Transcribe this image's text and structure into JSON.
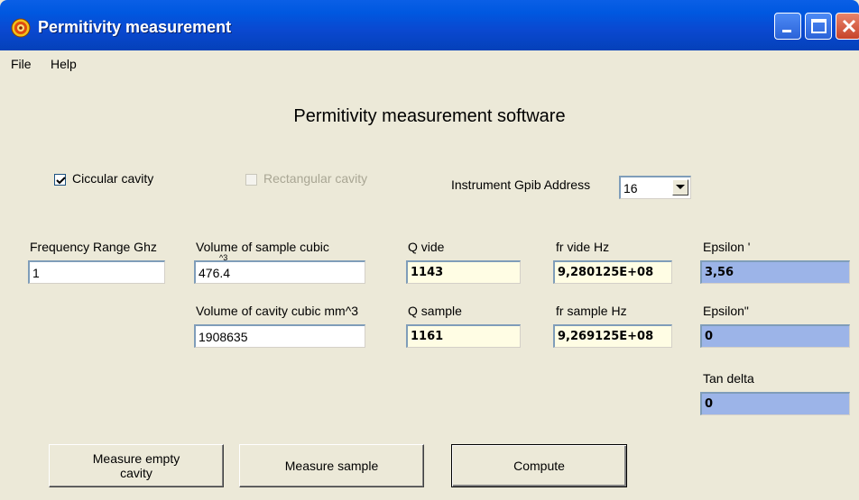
{
  "window": {
    "title": "Permitivity measurement"
  },
  "menu": [
    "File",
    "Help"
  ],
  "heading": "Permitivity measurement software",
  "options": {
    "circular_label": "Ciccular cavity",
    "circular_checked": true,
    "rectangular_label": "Rectangular cavity",
    "rectangular_checked": false,
    "gpib_label": "Instrument Gpib Address",
    "gpib_value": "16"
  },
  "inputs": {
    "frequency_label": "Frequency Range Ghz",
    "frequency_value": "1",
    "vol_sample_label": "Volume of sample cubic",
    "vol_sample_label_overflow": "^3",
    "vol_sample_value": "476.4",
    "vol_cavity_label": "Volume of cavity cubic mm^3",
    "vol_cavity_value": "1908635"
  },
  "results": {
    "q_vide_label": "Q vide",
    "q_vide_value": "1143",
    "fr_vide_label": "fr vide Hz",
    "fr_vide_value": "9,280125E+08",
    "eps1_label": "Epsilon '",
    "eps1_value": "3,56",
    "q_sample_label": "Q sample",
    "q_sample_value": "1161",
    "fr_sample_label": "fr sample Hz",
    "fr_sample_value": "9,269125E+08",
    "eps2_label": "Epsilon\"",
    "eps2_value": "0",
    "tan_label": "Tan delta",
    "tan_value": "0"
  },
  "buttons": {
    "measure_empty_line1": "Measure empty",
    "measure_empty_line2": "cavity",
    "measure_sample": "Measure sample",
    "compute": "Compute"
  },
  "colors": {
    "titlebar": "#0a48d0",
    "face": "#ece9d8",
    "result_yellow": "#fffde4",
    "result_blue": "#9cb4e8"
  }
}
